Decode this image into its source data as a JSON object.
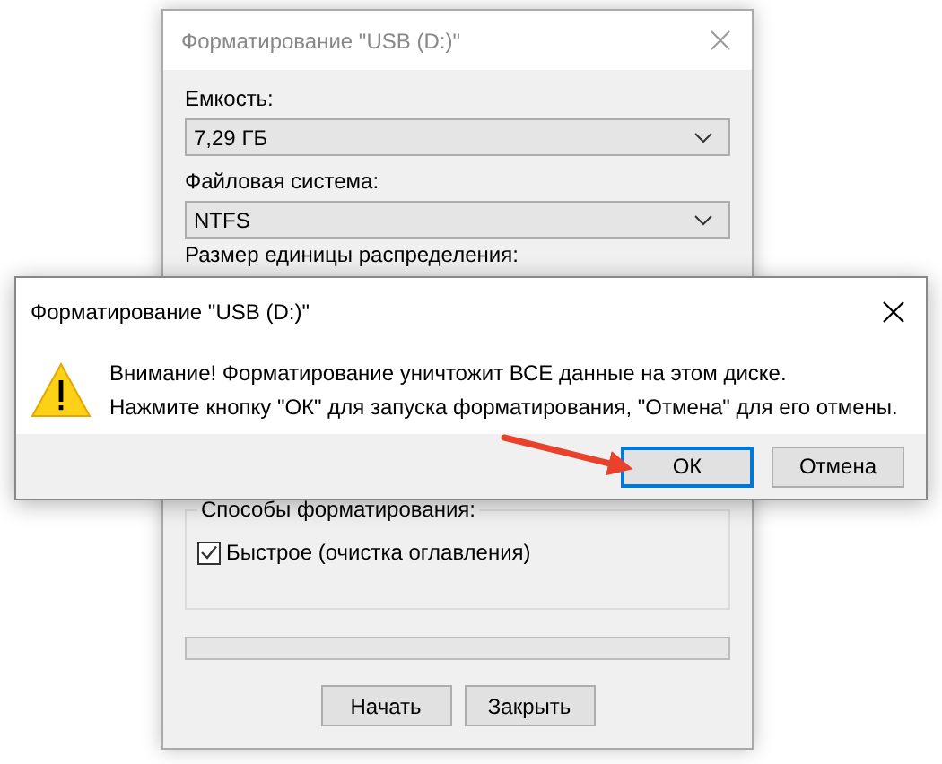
{
  "format_window": {
    "title": "Форматирование \"USB (D:)\"",
    "active": false,
    "fields": [
      {
        "label": "Емкость:",
        "value": "7,29 ГБ"
      },
      {
        "label": "Файловая система:",
        "value": "NTFS"
      }
    ],
    "partial_label": "Размер единицы распределения:",
    "options_group": {
      "title": "Способы форматирования:",
      "options": [
        {
          "label": "Быстрое (очистка оглавления)",
          "checked": true
        }
      ]
    },
    "progress": {
      "level": 0
    },
    "buttons": [
      "Начать",
      "Закрыть"
    ]
  },
  "message_box": {
    "title": "Форматирование \"USB (D:)\"",
    "lines": [
      "Внимание! Форматирование уничтожит ВСЕ данные на этом диске.",
      "Нажмите кнопку \"ОК\" для запуска форматирования, \"Отмена\" для его отмены."
    ],
    "buttons": [
      {
        "label": "ОК",
        "selected": true
      },
      {
        "label": "Отмена",
        "selected": false
      }
    ]
  },
  "annotation": {
    "kind": "arrow"
  }
}
